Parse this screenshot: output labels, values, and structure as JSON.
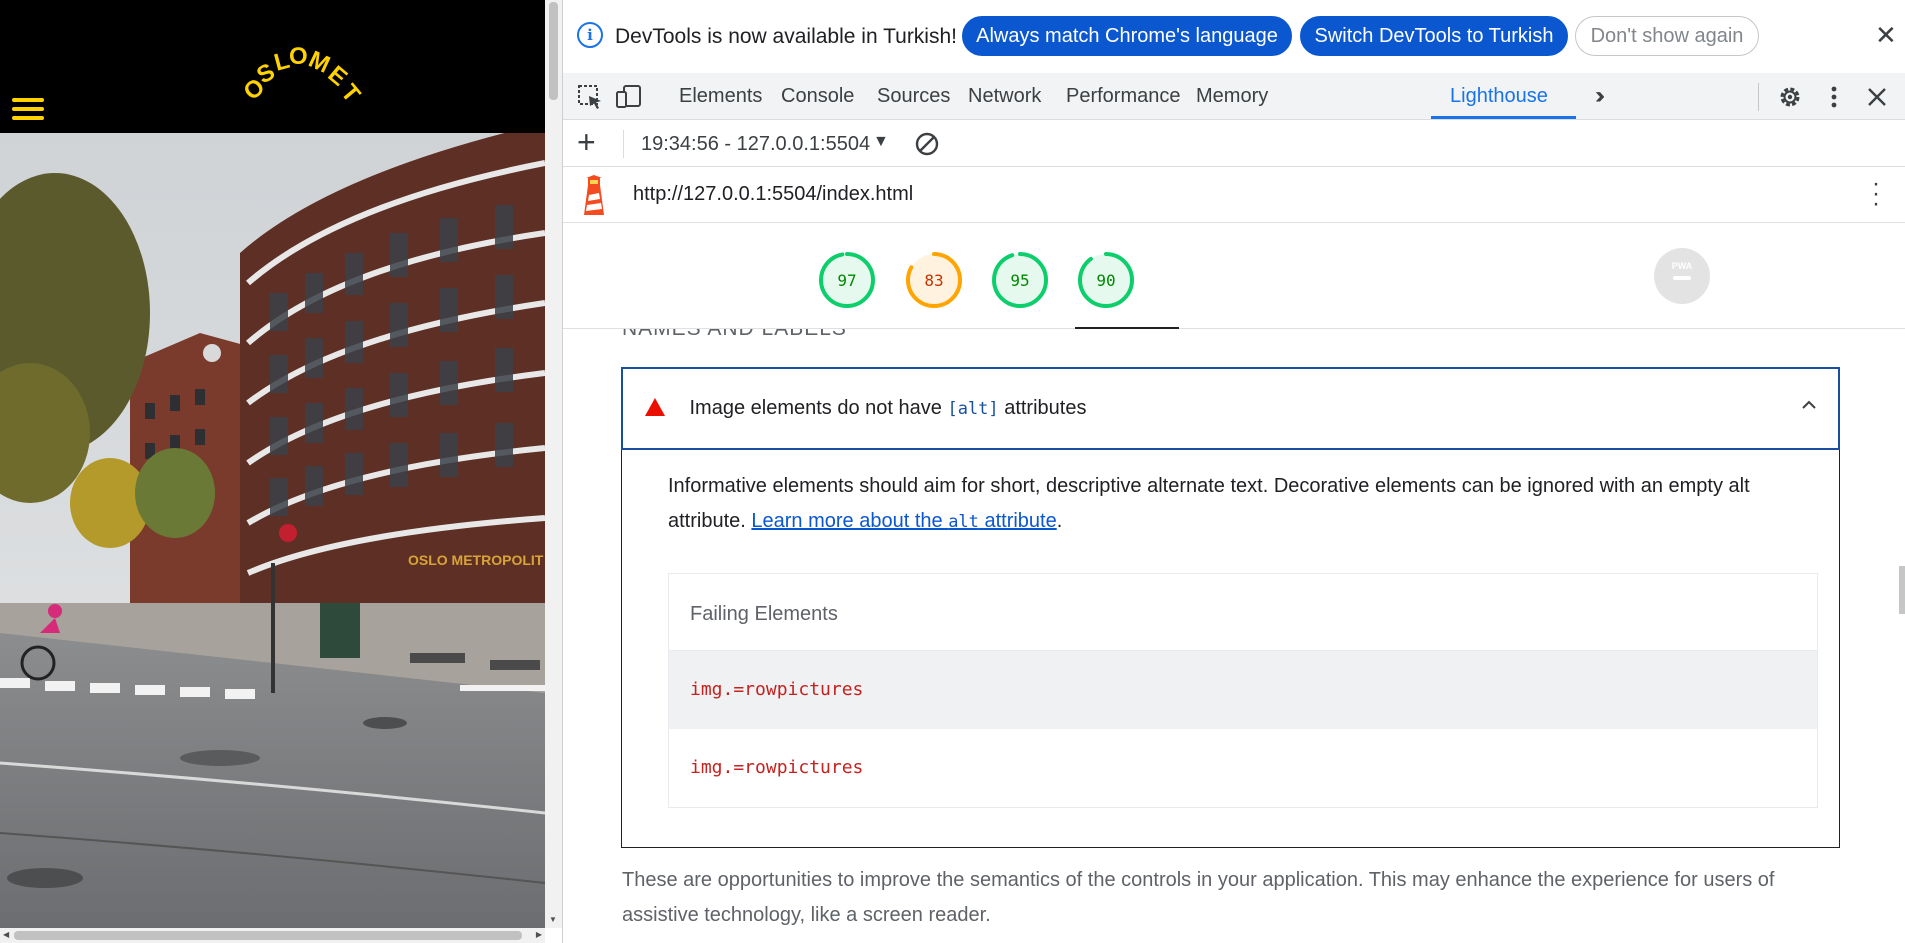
{
  "site": {
    "logo_text": "OSLOMET",
    "building_sign": "OSLO METROPOLIT",
    "accent_color": "#ffd200"
  },
  "infobar": {
    "message": "DevTools is now available in Turkish!",
    "match_language_label": "Always match Chrome's language",
    "switch_language_label": "Switch DevTools to Turkish",
    "dont_show_label": "Don't show again",
    "close_icon": "close-icon"
  },
  "tabs": [
    {
      "label": "Elements"
    },
    {
      "label": "Console"
    },
    {
      "label": "Sources"
    },
    {
      "label": "Network"
    },
    {
      "label": "Performance"
    },
    {
      "label": "Memory"
    },
    {
      "label": "Lighthouse",
      "active": true
    }
  ],
  "lighthouse": {
    "report_selector": "19:34:56 - 127.0.0.1:5504",
    "url": "http://127.0.0.1:5504/index.html",
    "scores": [
      {
        "value": 97,
        "color": "#0cce6b"
      },
      {
        "value": 83,
        "color": "#ffa400"
      },
      {
        "value": 95,
        "color": "#0cce6b"
      },
      {
        "value": 90,
        "color": "#0cce6b"
      }
    ],
    "pwa_label": "PWA",
    "group_title": "NAMES AND LABELS",
    "audit": {
      "title_before": "Image elements do not have ",
      "title_code": "[alt]",
      "title_after": " attributes",
      "desc_before": "Informative elements should aim for short, descriptive alternate text. Decorative elements can be ignored with an empty alt attribute. ",
      "link_before": "Learn more about the ",
      "link_code": "alt",
      "link_after": " attribute",
      "desc_after": ".",
      "table_header": "Failing Elements",
      "rows": [
        "img.=rowpictures",
        "img.=rowpictures"
      ]
    },
    "group_description": "These are opportunities to improve the semantics of the controls in your application. This may enhance the experience for users of assistive technology, like a screen reader."
  }
}
